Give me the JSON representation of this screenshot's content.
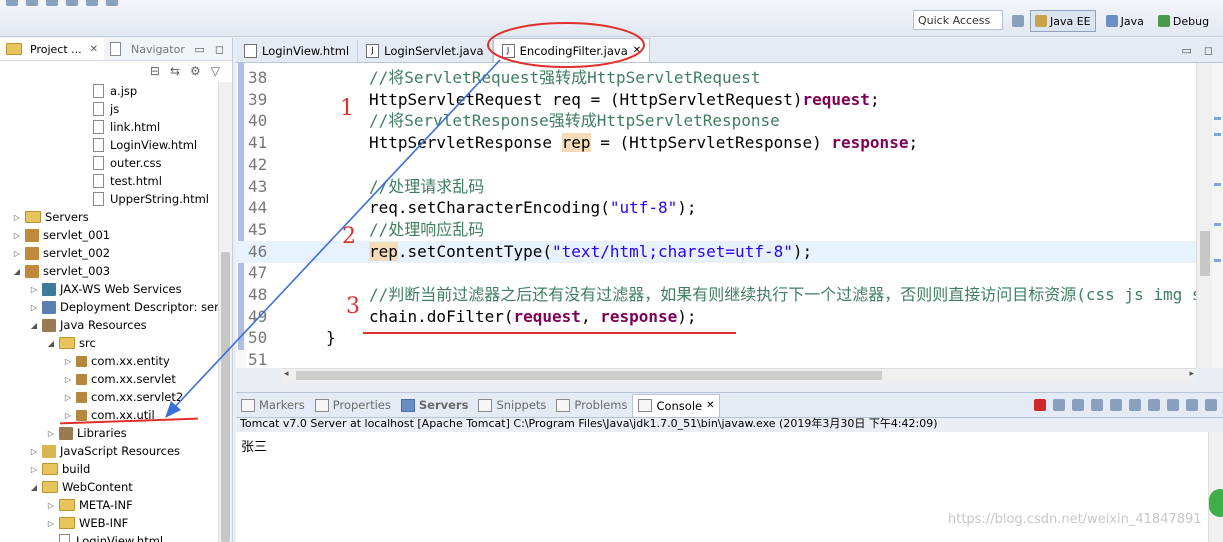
{
  "toolbar": {
    "quick_access": "Quick Access",
    "perspectives": [
      {
        "label": "Java EE",
        "active": true
      },
      {
        "label": "Java",
        "active": false
      },
      {
        "label": "Debug",
        "active": false
      }
    ]
  },
  "explorer": {
    "tab_project": "Project ...",
    "tab_navigator": "Navigator",
    "tree": [
      {
        "label": "a.jsp",
        "indent": 4,
        "icon": "file",
        "toggle": ""
      },
      {
        "label": "js",
        "indent": 4,
        "icon": "file",
        "toggle": ""
      },
      {
        "label": "link.html",
        "indent": 4,
        "icon": "file",
        "toggle": ""
      },
      {
        "label": "LoginView.html",
        "indent": 4,
        "icon": "file",
        "toggle": ""
      },
      {
        "label": "outer.css",
        "indent": 4,
        "icon": "file",
        "toggle": ""
      },
      {
        "label": "test.html",
        "indent": 4,
        "icon": "file",
        "toggle": ""
      },
      {
        "label": "UpperString.html",
        "indent": 4,
        "icon": "file",
        "toggle": ""
      },
      {
        "label": "Servers",
        "indent": 0,
        "icon": "folder",
        "toggle": "collapsed"
      },
      {
        "label": "servlet_001",
        "indent": 0,
        "icon": "proj",
        "toggle": "collapsed"
      },
      {
        "label": "servlet_002",
        "indent": 0,
        "icon": "proj",
        "toggle": "collapsed"
      },
      {
        "label": "servlet_003",
        "indent": 0,
        "icon": "proj",
        "toggle": "expanded"
      },
      {
        "label": "JAX-WS Web Services",
        "indent": 1,
        "icon": "ws",
        "toggle": "collapsed"
      },
      {
        "label": "Deployment Descriptor: servle",
        "indent": 1,
        "icon": "dd",
        "toggle": "collapsed"
      },
      {
        "label": "Java Resources",
        "indent": 1,
        "icon": "lib",
        "toggle": "expanded"
      },
      {
        "label": "src",
        "indent": 2,
        "icon": "folder",
        "toggle": "expanded"
      },
      {
        "label": "com.xx.entity",
        "indent": 3,
        "icon": "pkg",
        "toggle": "collapsed"
      },
      {
        "label": "com.xx.servlet",
        "indent": 3,
        "icon": "pkg",
        "toggle": "collapsed"
      },
      {
        "label": "com.xx.servlet2",
        "indent": 3,
        "icon": "pkg",
        "toggle": "collapsed"
      },
      {
        "label": "com.xx.util",
        "indent": 3,
        "icon": "pkg",
        "toggle": "collapsed"
      },
      {
        "label": "Libraries",
        "indent": 2,
        "icon": "lib",
        "toggle": "collapsed"
      },
      {
        "label": "JavaScript Resources",
        "indent": 1,
        "icon": "js",
        "toggle": "collapsed"
      },
      {
        "label": "build",
        "indent": 1,
        "icon": "folder",
        "toggle": "collapsed"
      },
      {
        "label": "WebContent",
        "indent": 1,
        "icon": "folder",
        "toggle": "expanded"
      },
      {
        "label": "META-INF",
        "indent": 2,
        "icon": "folder",
        "toggle": "collapsed"
      },
      {
        "label": "WEB-INF",
        "indent": 2,
        "icon": "folder",
        "toggle": "collapsed"
      },
      {
        "label": "LoginView.html",
        "indent": 2,
        "icon": "file",
        "toggle": ""
      }
    ]
  },
  "editor": {
    "tabs": [
      {
        "label": "LoginView.html",
        "icon": "html",
        "active": false
      },
      {
        "label": "LoginServlet.java",
        "icon": "java",
        "active": false
      },
      {
        "label": "EncodingFilter.java",
        "icon": "java",
        "active": true
      }
    ],
    "lines": [
      {
        "num": "38",
        "segments": [
          {
            "t": "//将ServletRequest强转成HttpServletRequest",
            "c": "cmt"
          }
        ]
      },
      {
        "num": "39",
        "segments": [
          {
            "t": "HttpServletRequest ",
            "c": "var"
          },
          {
            "t": "req",
            "c": "var"
          },
          {
            "t": " = (HttpServletRequest)",
            "c": "var"
          },
          {
            "t": "request",
            "c": "kw"
          },
          {
            "t": ";",
            "c": "var"
          }
        ]
      },
      {
        "num": "40",
        "segments": [
          {
            "t": "//将ServletResponse强转成HttpServletResponse",
            "c": "cmt"
          }
        ]
      },
      {
        "num": "41",
        "segments": [
          {
            "t": "HttpServletResponse ",
            "c": "var"
          },
          {
            "t": "rep",
            "c": "hl"
          },
          {
            "t": " = (HttpServletResponse) ",
            "c": "var"
          },
          {
            "t": "response",
            "c": "kw"
          },
          {
            "t": ";",
            "c": "var"
          }
        ]
      },
      {
        "num": "42",
        "segments": []
      },
      {
        "num": "43",
        "segments": [
          {
            "t": "//处理请求乱码",
            "c": "cmt"
          }
        ]
      },
      {
        "num": "44",
        "segments": [
          {
            "t": "req.setCharacterEncoding(",
            "c": "var"
          },
          {
            "t": "\"utf-8\"",
            "c": "str"
          },
          {
            "t": ");",
            "c": "var"
          }
        ]
      },
      {
        "num": "45",
        "segments": [
          {
            "t": "//处理响应乱码",
            "c": "cmt"
          }
        ]
      },
      {
        "num": "46",
        "segments": [
          {
            "t": "rep",
            "c": "hl"
          },
          {
            "t": ".setContentType(",
            "c": "var"
          },
          {
            "t": "\"text/html;charset=utf-8\"",
            "c": "str"
          },
          {
            "t": ");",
            "c": "var"
          }
        ]
      },
      {
        "num": "47",
        "segments": []
      },
      {
        "num": "48",
        "segments": [
          {
            "t": "//判断当前过滤器之后还有没有过滤器，如果有则继续执行下一个过滤器，否则则直接访问目标资源(css js img servlet",
            "c": "cmt"
          }
        ]
      },
      {
        "num": "49",
        "segments": [
          {
            "t": "chain.doFilter(",
            "c": "var"
          },
          {
            "t": "request",
            "c": "kw"
          },
          {
            "t": ", ",
            "c": "var"
          },
          {
            "t": "response",
            "c": "kw"
          },
          {
            "t": ");",
            "c": "var"
          }
        ]
      },
      {
        "num": "50",
        "segments": [
          {
            "t": "}",
            "c": "var"
          }
        ]
      },
      {
        "num": "51",
        "segments": []
      }
    ],
    "current_line": "46"
  },
  "annotations": {
    "n1": "1",
    "n2": "2",
    "n3": "3"
  },
  "console": {
    "tabs": [
      {
        "label": "Markers",
        "active": false
      },
      {
        "label": "Properties",
        "active": false
      },
      {
        "label": "Servers",
        "active": false
      },
      {
        "label": "Snippets",
        "active": false
      },
      {
        "label": "Problems",
        "active": false
      },
      {
        "label": "Console",
        "active": true
      }
    ],
    "status": "Tomcat v7.0 Server at localhost [Apache Tomcat] C:\\Program Files\\Java\\jdk1.7.0_51\\bin\\javaw.exe (2019年3月30日 下午4:42:09)",
    "output": "张三"
  },
  "watermark": "https://blog.csdn.net/weixin_41847891"
}
